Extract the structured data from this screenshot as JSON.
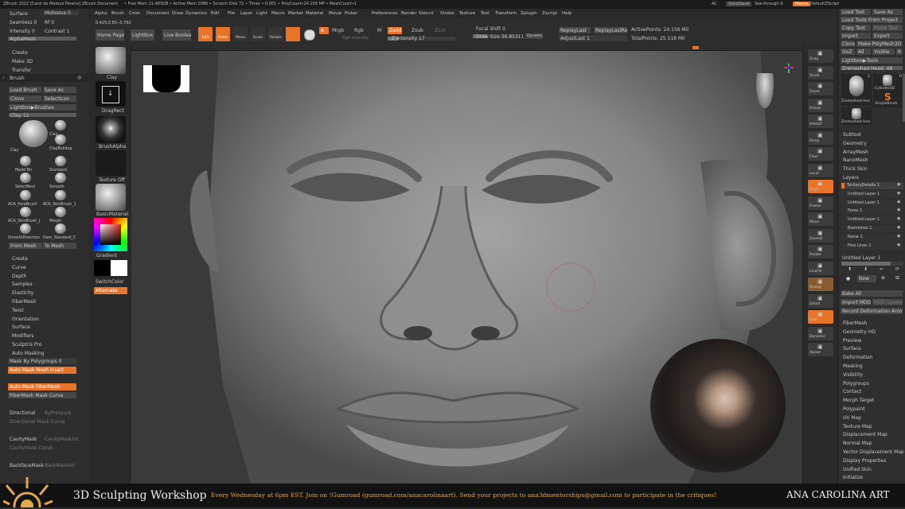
{
  "titlebar": {
    "app": "ZBrush 2022 [Carol de Mateus Pereira]  ZBrush Document",
    "mem": "• Free Mem 11.483GB • Active Mem 1086 • Scratch Disk 72 • Timer • 0.001 • PolyCount•24.156 MP • MeshCount•1",
    "ac": "AC",
    "quicksave": "QuickSave",
    "seethrough": "See-through  0",
    "menus": "Menus",
    "defaultscript": "DefaultZScript"
  },
  "menubar": [
    "Alpha",
    "Brush",
    "Color",
    "Document",
    "Draw",
    "Dynamics",
    "Edit",
    "File",
    "Layer",
    "Light",
    "Macro",
    "Marker",
    "Material",
    "Movie",
    "Picker",
    "Preferences",
    "Render",
    "Stencil",
    "Stroke",
    "Texture",
    "Tool",
    "Transform",
    "Zplugin",
    "Zscript",
    "Help"
  ],
  "coords": "0.425,0.65,-0.792",
  "topbar": {
    "home_page": "Home Page",
    "lightbox": "LightBox",
    "live_boolean": "Live Boolean",
    "edit": "Edit",
    "draw": "Draw",
    "move": "Move",
    "scale": "Scale",
    "rotate": "Rotate",
    "a": "A",
    "mrgb": "Mrgb",
    "rgb": "Rgb",
    "m": "M",
    "zadd": "Zadd",
    "zsub": "Zsub",
    "zcut": "Zcut",
    "rgb_intensity": "Rgb Intensity",
    "z_intensity": "Z Intensity 17",
    "focal_shift": "Focal Shift 0",
    "draw_size": "Draw Size 36.85311",
    "dynamic": "Dynamic",
    "replay_last": "ReplayLast",
    "replay_last_rel": "ReplayLastRel",
    "adjust_last": "AdjustLast 1",
    "active_points": "ActivePoints: 24.156 Mil",
    "total_points": "TotalPoints: 25.518 Mil"
  },
  "left_panel": {
    "surface": "Surface",
    "seamless": "Seamless 0",
    "midvalue": "MidValue 0",
    "rf": "Rf 0",
    "intensity": "Intensity 0",
    "contrast": "Contrast 1",
    "alpha_mesh": "AlphaMesh",
    "create": "Create",
    "make3d": "Make 3D",
    "transfer": "Transfer",
    "brush_title": "Brush",
    "load_brush": "Load Brush",
    "save_as": "Save As",
    "clone": "Clone",
    "select_icon": "SelectIcon",
    "lightbox_brushes": "Lightbox▶Brushes",
    "clay_value": "Clay. 11",
    "brushes": [
      "Clay",
      "Clay",
      "ClayBuildup",
      "Madd Bri",
      "Standard",
      "SelectRect",
      "Smooth",
      "ACA_PoreBrush",
      "ACA_SkinBrush_1",
      "ACA_SkinBrush_J",
      "Morph",
      "SmoothDirection",
      "Dam_Standard_C",
      "From Mesh",
      "To Mesh"
    ],
    "sections": [
      "Create",
      "Curve",
      "Depth",
      "Samples",
      "Elasticity",
      "FiberMesh",
      "Twist",
      "Orientation",
      "Surface",
      "Modifiers",
      "Sculptris Pro",
      "Auto Masking"
    ],
    "mask_by_polygroups": "Mask By Polygroups 0",
    "auto_mask_mesh_insert": "Auto Mask Mesh Insert",
    "auto_mask_fibermesh": "Auto Mask FiberMesh",
    "fibermesh_mask_curve": "FiberMesh Mask Curve",
    "directional": "Directional",
    "by_pressure": "ByPressure",
    "directional_mask_curve": "Directional Mask Curve",
    "cavity_mask": "CavityMask",
    "cavity_mask_int": "CavityMaskInt",
    "cavity_mask_curve": "CavityMask Curve",
    "backface_mask": "BackfaceMask",
    "backmask_int": "BackMaskInt"
  },
  "tray2": {
    "clay": "Clay",
    "dragrect": "DragRect",
    "brush_alpha": "BrushAlpha",
    "texture_off": "Texture Off",
    "basic_material": "BasicMaterial",
    "gradient": "Gradient",
    "switch_color": "SwitchColor",
    "alternate": "Alternate"
  },
  "right_tools": [
    "Snap",
    "Scroll",
    "Zoom",
    "Actual",
    "AAHalf",
    "Persp",
    "Floor",
    "Local",
    "Gxyz",
    "Frame",
    "Move",
    "ZoomD",
    "Rotate",
    "LineFill",
    "Transp",
    "Ghost",
    "Solo",
    "Dynamic",
    "Xpose"
  ],
  "right_panel": {
    "load_tool": "Load Tool",
    "save_as": "Save As",
    "load_tools_from_project": "Load Tools From Project",
    "copy_tool": "Copy Tool",
    "paste_tool": "Paste Tool",
    "import": "Import",
    "export": "Export",
    "clone": "Clone",
    "make_polymesh": "Make PolyMesh3D",
    "goz": "GoZ",
    "all": "All",
    "visible": "Visible",
    "r": "R",
    "lightbox_tools": "Lightbox▶Tools",
    "tool_value": "Zremeshed Head. 48",
    "thumb1": "Zremeshed Hea",
    "thumb2": "Cylinder3D",
    "thumb3": "SimpleBrush",
    "thumb4": "Zremeshed Hea",
    "num_left": "2",
    "num_right": "R",
    "subtool": "Subtool",
    "geometry": "Geometry",
    "arraymesh": "ArrayMesh",
    "nanomesh": "NanoMesh",
    "thick_skin": "Thick Skin",
    "layers_title": "Layers",
    "layers": [
      "TertiaryDetails 1",
      "Untitled Layer 1",
      "Untitled Layer 1",
      "Pores 1",
      "Untitled Layer 1",
      "Blemishes 1",
      "Noise 1",
      "Fine Lines 1"
    ],
    "untitled_layer": "Untitled Layer 1",
    "new": "New",
    "bake_all": "Bake All",
    "import_mdd": "Import MDD",
    "mdd_speed": "MDD Speed",
    "record_deformation": "Record Deformation Animation",
    "sections": [
      "FiberMesh",
      "Geometry HD",
      "Preview",
      "Surface",
      "Deformation",
      "Masking",
      "Visibility",
      "Polygroups",
      "Contact",
      "Morph Target",
      "Polypaint",
      "UV Map",
      "Texture Map",
      "Displacement Map",
      "Normal Map",
      "Vector Displacement Map",
      "Display Properties",
      "Unified Skin",
      "Initialize"
    ]
  },
  "banner": {
    "workshop": "3D Sculpting Workshop",
    "message": "Every Wednesday at 6pm EST. Join on !Gumroad (gumroad.com/anacarolinaart). Send your projects to ana3dmentorships@gmail.com to participate in the critiques!",
    "brand": "ANA CAROLINA ART"
  },
  "colors": {
    "accent": "#e8742a",
    "panel": "#2e2e2e",
    "banner_text": "#e3a64a"
  }
}
